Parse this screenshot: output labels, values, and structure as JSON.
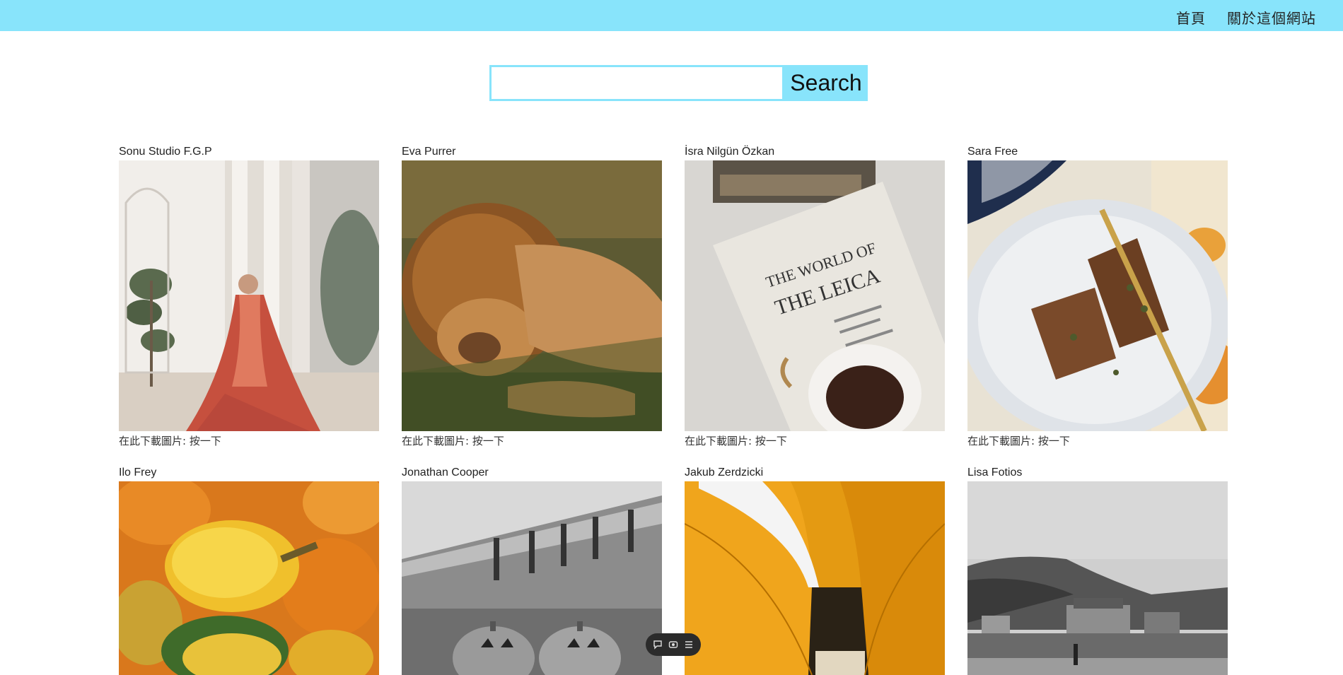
{
  "nav": {
    "home": "首頁",
    "about": "關於這個網站"
  },
  "search": {
    "value": "",
    "placeholder": "",
    "button_label": "Search"
  },
  "download_label": "在此下載圖片: 按一下",
  "photos": [
    {
      "author": "Sonu Studio F.G.P"
    },
    {
      "author": "Eva Purrer"
    },
    {
      "author": "İsra Nilgün Özkan"
    },
    {
      "author": "Sara Free"
    },
    {
      "author": "Ilo Frey"
    },
    {
      "author": "Jonathan Cooper"
    },
    {
      "author": "Jakub Zerdzicki"
    },
    {
      "author": "Lisa Fotios"
    }
  ],
  "photo3_text": {
    "line1": "THE WORLD OF",
    "line2": "THE LEICA"
  },
  "colors": {
    "accent": "#88e4fb"
  },
  "floating_toolbar": {
    "icons": [
      "chat-bubble-icon",
      "eye-icon",
      "menu-icon"
    ]
  }
}
